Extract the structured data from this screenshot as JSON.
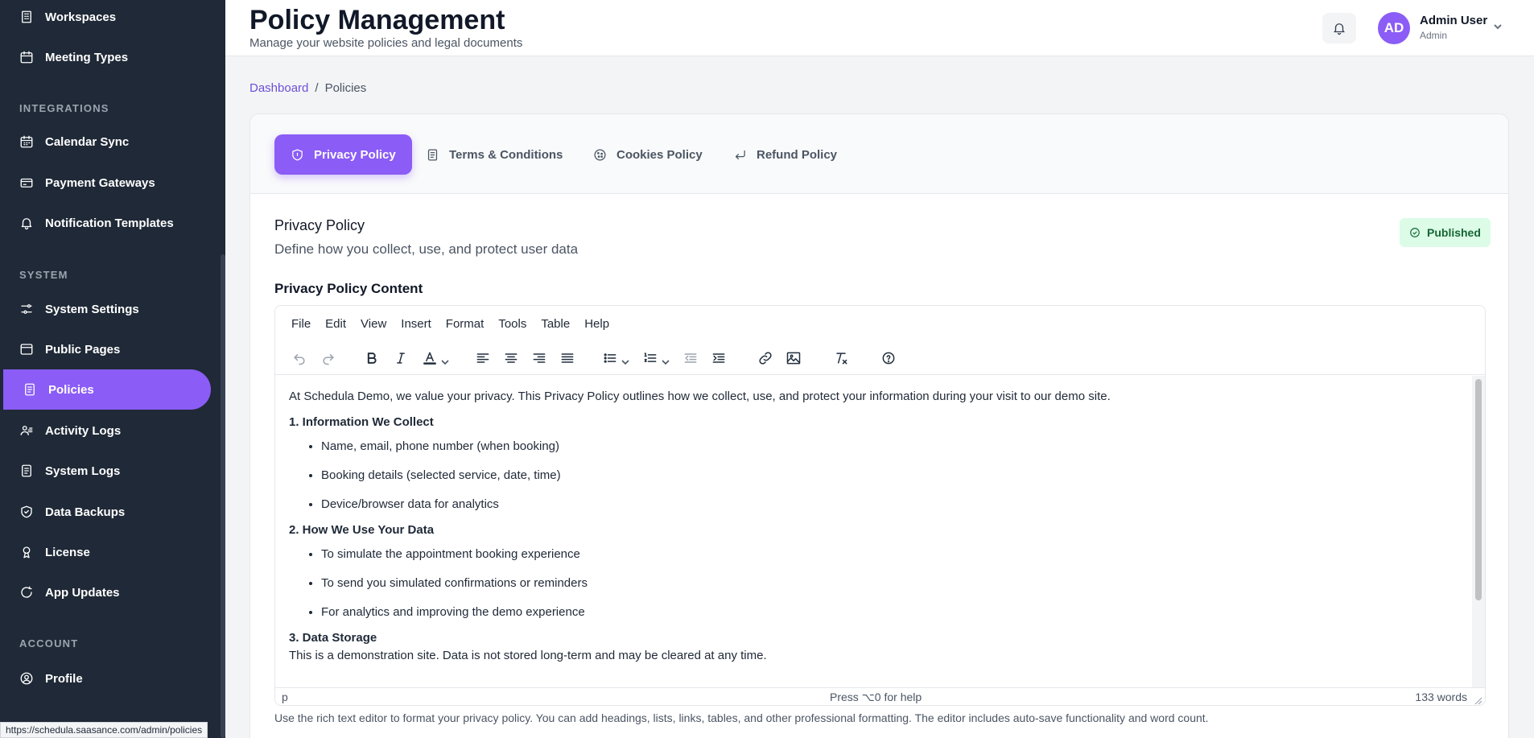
{
  "sidebar": {
    "top_items": [
      {
        "label": "Workspaces",
        "icon": "building-icon"
      },
      {
        "label": "Meeting Types",
        "icon": "calendar-icon"
      }
    ],
    "sections": {
      "integrations": "INTEGRATIONS",
      "system": "SYSTEM",
      "account": "ACCOUNT"
    },
    "integrations": [
      {
        "label": "Calendar Sync",
        "icon": "calendar-grid-icon"
      },
      {
        "label": "Payment Gateways",
        "icon": "credit-card-icon"
      },
      {
        "label": "Notification Templates",
        "icon": "bell-icon"
      }
    ],
    "system": [
      {
        "label": "System Settings",
        "icon": "sliders-icon"
      },
      {
        "label": "Public Pages",
        "icon": "browser-icon"
      },
      {
        "label": "Policies",
        "icon": "document-icon"
      },
      {
        "label": "Activity Logs",
        "icon": "users-icon"
      },
      {
        "label": "System Logs",
        "icon": "document-icon"
      },
      {
        "label": "Data Backups",
        "icon": "shield-icon"
      },
      {
        "label": "License",
        "icon": "key-icon"
      },
      {
        "label": "App Updates",
        "icon": "refresh-icon"
      }
    ],
    "account": [
      {
        "label": "Profile",
        "icon": "user-circle-icon"
      }
    ],
    "active": "Policies"
  },
  "header": {
    "title": "Policy Management",
    "subtitle": "Manage your website policies and legal documents",
    "user_name": "Admin User",
    "user_role": "Admin",
    "avatar_initials": "AD"
  },
  "breadcrumb": {
    "home": "Dashboard",
    "separator": "/",
    "current": "Policies"
  },
  "tabs": [
    {
      "label": "Privacy Policy",
      "icon": "shield-icon",
      "active": true
    },
    {
      "label": "Terms & Conditions",
      "icon": "document-icon",
      "active": false
    },
    {
      "label": "Cookies Policy",
      "icon": "cookie-icon",
      "active": false
    },
    {
      "label": "Refund Policy",
      "icon": "return-arrow-icon",
      "active": false
    }
  ],
  "policy": {
    "title": "Privacy Policy",
    "description": "Define how you collect, use, and protect user data",
    "status": "Published",
    "content_label": "Privacy Policy Content"
  },
  "editor": {
    "menu": [
      "File",
      "Edit",
      "View",
      "Insert",
      "Format",
      "Tools",
      "Table",
      "Help"
    ],
    "content": {
      "intro": "At Schedula Demo, we value your privacy. This Privacy Policy outlines how we collect, use, and protect your information during your visit to our demo site.",
      "h1": "1. Information We Collect",
      "list1": [
        "Name, email, phone number (when booking)",
        "Booking details (selected service, date, time)",
        "Device/browser data for analytics"
      ],
      "h2": "2. How We Use Your Data",
      "list2": [
        "To simulate the appointment booking experience",
        "To send you simulated confirmations or reminders",
        "For analytics and improving the demo experience"
      ],
      "h3": "3. Data Storage",
      "p3": "This is a demonstration site. Data is not stored long-term and may be cleared at any time."
    },
    "status_path": "p",
    "status_help": "Press ⌥0 for help",
    "word_count": "133 words"
  },
  "help_text": "Use the rich text editor to format your privacy policy. You can add headings, lists, links, tables, and other professional formatting. The editor includes auto-save functionality and word count.",
  "url_tooltip": "https://schedula.saasance.com/admin/policies",
  "colors": {
    "accent": "#8b5cf6",
    "sidebar_bg": "#1f2937",
    "published_bg": "#dcfce7",
    "published_text": "#166534"
  }
}
